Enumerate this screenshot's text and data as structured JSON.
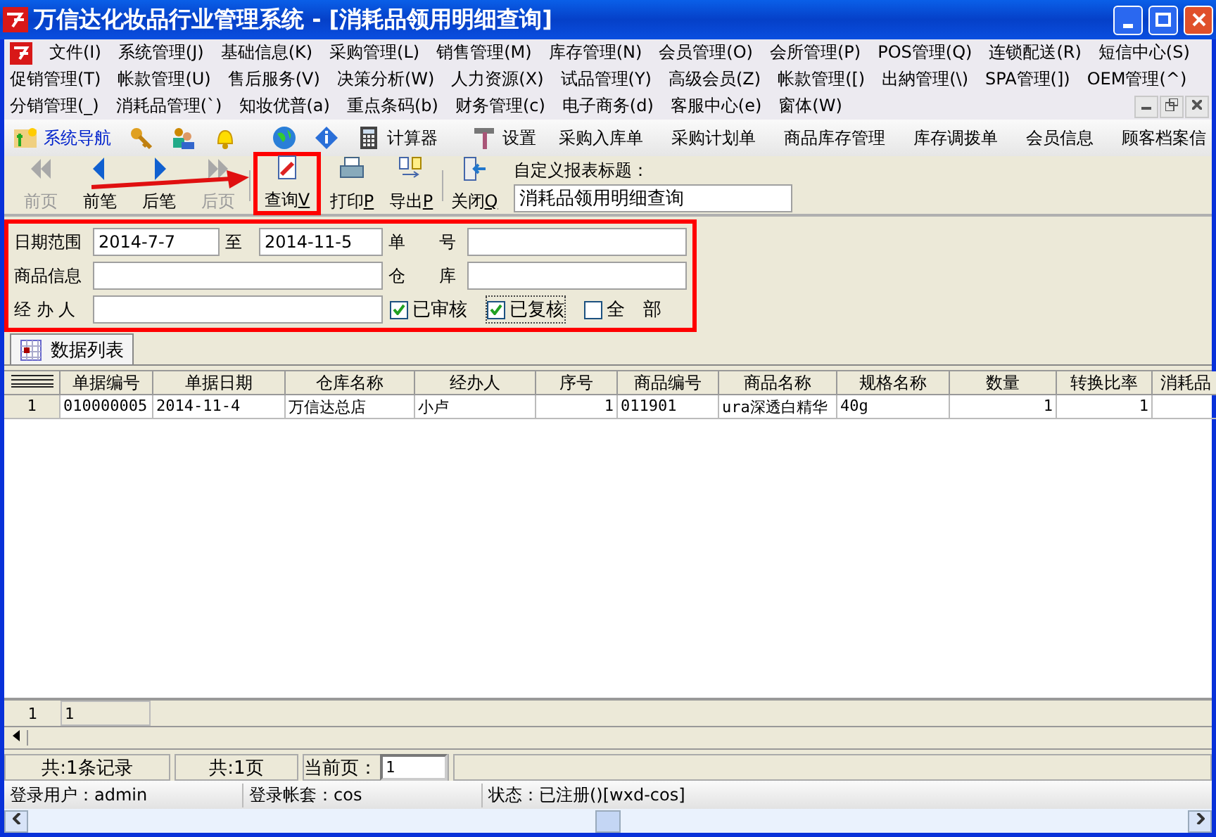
{
  "window": {
    "title": "万信达化妆品行业管理系统 - [消耗品领用明细查询]"
  },
  "menu_rows": [
    [
      "文件(I)",
      "系统管理(J)",
      "基础信息(K)",
      "采购管理(L)",
      "销售管理(M)",
      "库存管理(N)",
      "会员管理(O)",
      "会所管理(P)",
      "POS管理(Q)",
      "连锁配送(R)",
      "短信中心(S)"
    ],
    [
      "促销管理(T)",
      "帐款管理(U)",
      "售后服务(V)",
      "决策分析(W)",
      "人力资源(X)",
      "试品管理(Y)",
      "高级会员(Z)",
      "帐款管理([)",
      "出納管理(\\)",
      "SPA管理(])",
      "OEM管理(^)"
    ],
    [
      "分销管理(_)",
      "消耗品管理(`)",
      "知妆优普(a)",
      "重点条码(b)",
      "财务管理(c)",
      "电子商务(d)",
      "客服中心(e)",
      "窗体(W)"
    ]
  ],
  "shortcuts": [
    {
      "kind": "nav",
      "label": "系统导航"
    },
    {
      "kind": "key"
    },
    {
      "kind": "users"
    },
    {
      "kind": "bell"
    },
    {
      "kind": "sep"
    },
    {
      "kind": "globe"
    },
    {
      "kind": "info"
    },
    {
      "kind": "calc",
      "label": "计算器"
    },
    {
      "kind": "sep"
    },
    {
      "kind": "tools",
      "label": "设置"
    },
    {
      "kind": "text",
      "label": "采购入库单"
    },
    {
      "kind": "text",
      "label": "采购计划单"
    },
    {
      "kind": "text",
      "label": "商品库存管理"
    },
    {
      "kind": "text",
      "label": "库存调拨单"
    },
    {
      "kind": "text",
      "label": "会员信息"
    },
    {
      "kind": "text",
      "label": "顾客档案信"
    }
  ],
  "toolbar": [
    {
      "kind": "first",
      "label": "前页",
      "disabled": true
    },
    {
      "kind": "prev",
      "label": "前笔",
      "disabled": false
    },
    {
      "kind": "next",
      "label": "后笔",
      "disabled": false
    },
    {
      "kind": "last",
      "label": "后页",
      "disabled": true
    },
    {
      "kind": "sep"
    },
    {
      "kind": "query",
      "label": "查询",
      "key": "V",
      "disabled": false
    },
    {
      "kind": "print",
      "label": "打印",
      "key": "P",
      "disabled": false
    },
    {
      "kind": "export",
      "label": "导出",
      "key": "P",
      "disabled": false
    },
    {
      "kind": "sep"
    },
    {
      "kind": "close",
      "label": "关闭",
      "key": "Q",
      "disabled": false
    }
  ],
  "report_title": {
    "label": "自定义报表标题：",
    "value": "消耗品领用明细查询"
  },
  "filters": {
    "date_label": "日期范围",
    "date_from": "2014-7-7",
    "to_label": "至",
    "date_to": "2014-11-5",
    "number_label": "单　　号",
    "goods_label": "商品信息",
    "warehouse_label": "仓　　库",
    "handler_label": "经 办 人",
    "checks": [
      {
        "label": "已审核",
        "checked": true,
        "focused": false
      },
      {
        "label": "已复核",
        "checked": true,
        "focused": true
      },
      {
        "label": "全　部",
        "checked": false,
        "focused": false
      }
    ]
  },
  "tabs": [
    {
      "label": "数据列表",
      "selected": true
    }
  ],
  "table": {
    "columns": [
      "单据编号",
      "单据日期",
      "仓库名称",
      "经办人",
      "序号",
      "商品编号",
      "商品名称",
      "规格名称",
      "数量",
      "转换比率",
      "消耗品"
    ],
    "rows": [
      {
        "index": "1",
        "cells": [
          "010000005",
          "2014-11-4",
          "万信达总店",
          "小卢",
          "1",
          "011901",
          "ura深透白精华",
          "40g",
          "1",
          "1",
          ""
        ]
      }
    ],
    "footer": [
      "1",
      "1"
    ]
  },
  "pager": {
    "records": "共:1条记录",
    "pages": "共:1页",
    "current_label": "当前页：",
    "current": "1"
  },
  "status_bar": [
    "登录用户：admin",
    "登录帐套：cos",
    "状态：已注册()[wxd-cos]"
  ]
}
